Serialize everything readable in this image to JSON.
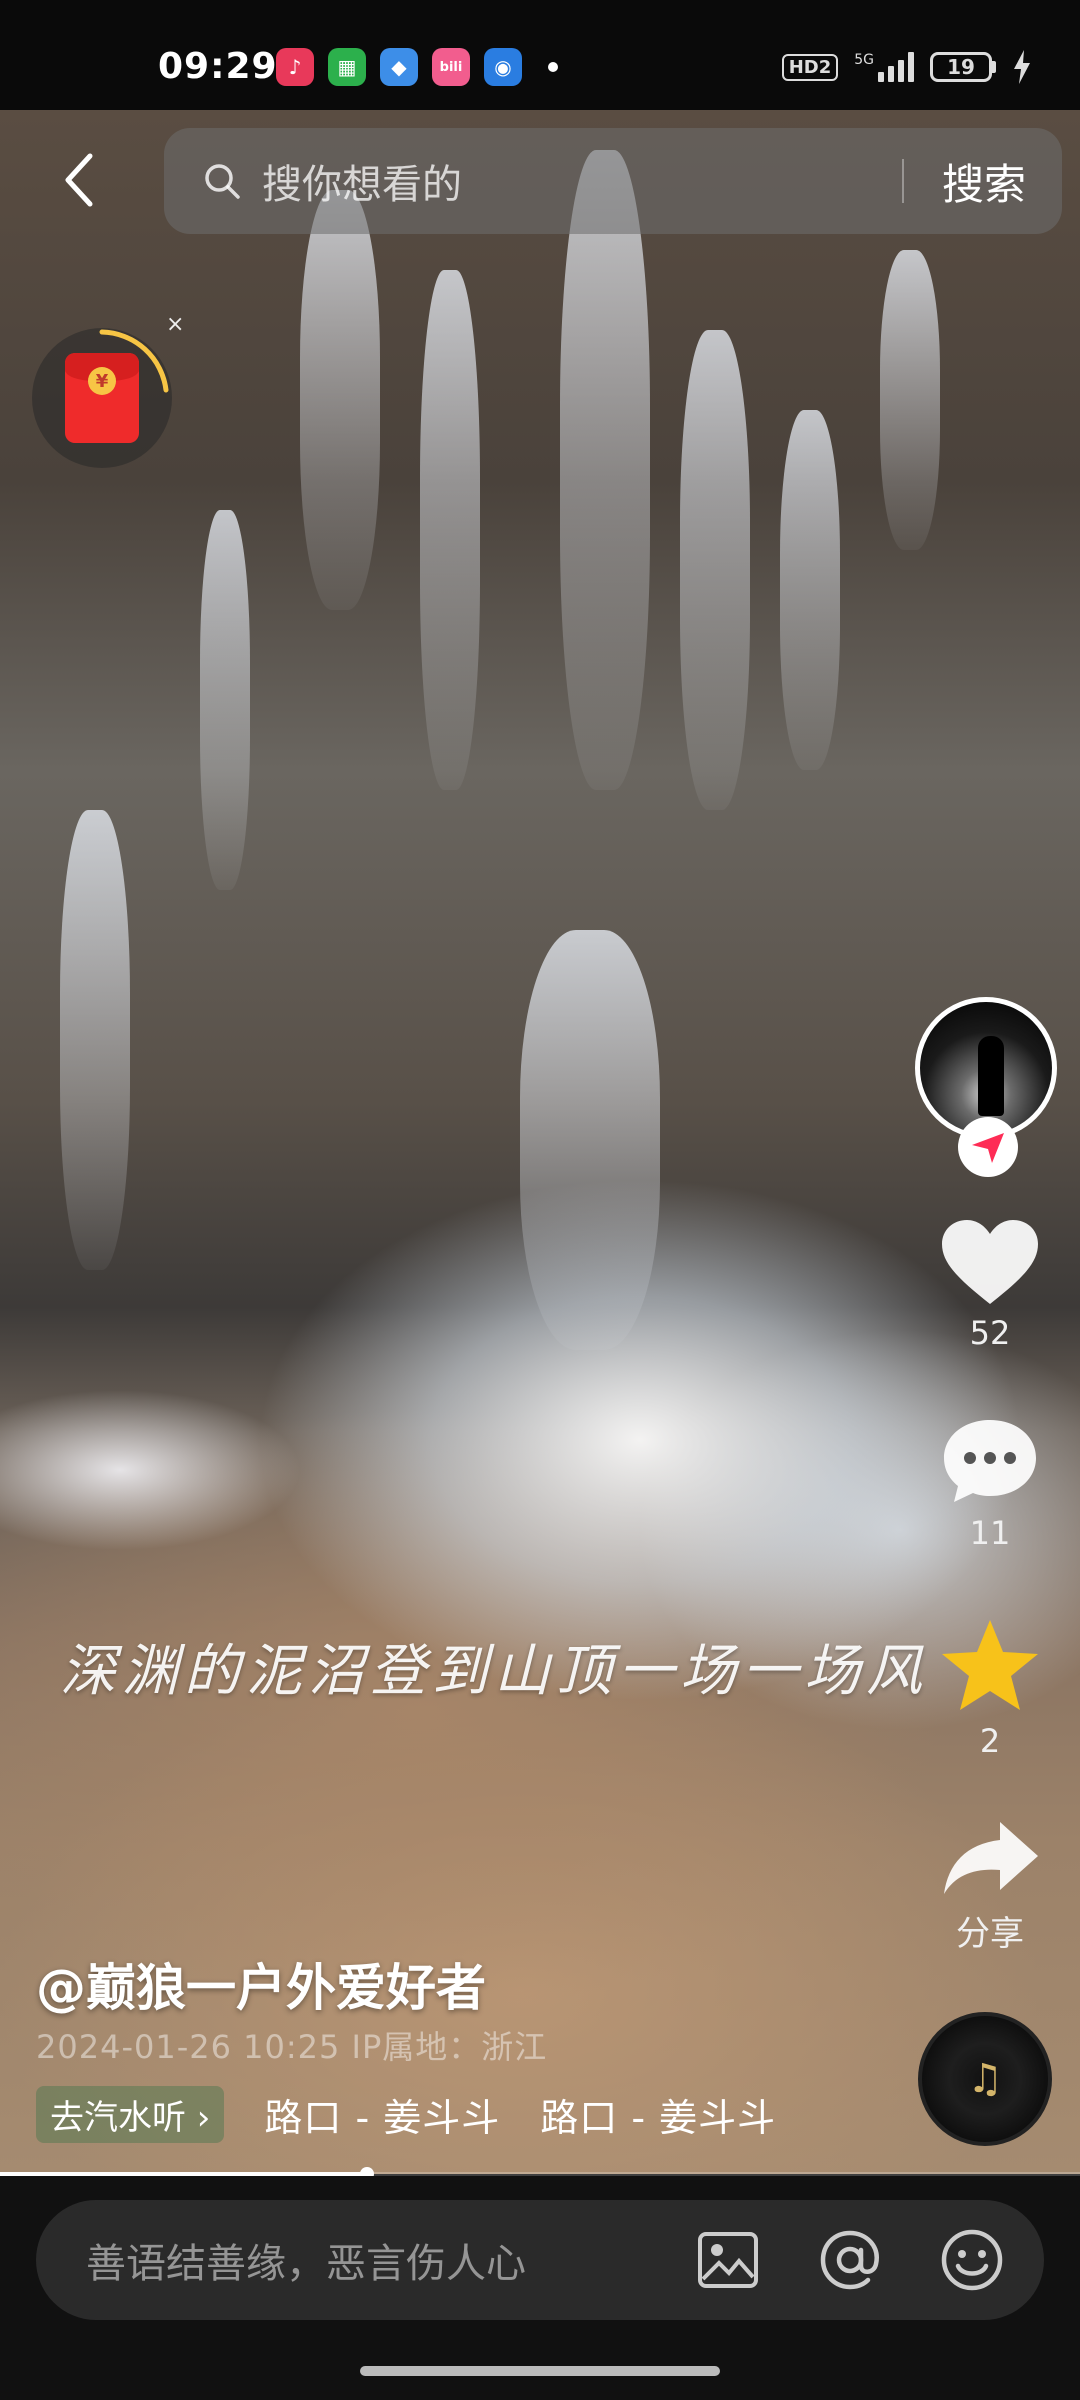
{
  "status_bar": {
    "time": "09:29",
    "hd_label": "HD2",
    "network_label": "5G",
    "battery_level": "19",
    "app_icons": [
      {
        "name": "music-app-icon",
        "color": "#e8395a",
        "glyph": "♪"
      },
      {
        "name": "green-app-icon",
        "color": "#2cb04c",
        "glyph": "▦"
      },
      {
        "name": "blue-app-icon",
        "color": "#3d8ee8",
        "glyph": "◆"
      },
      {
        "name": "bilibili-app-icon",
        "color": "#f25d8e",
        "glyph": "bili"
      },
      {
        "name": "browser-app-icon",
        "color": "#2a7de1",
        "glyph": "◉"
      }
    ]
  },
  "search": {
    "placeholder": "搜你想看的",
    "button_label": "搜索"
  },
  "red_packet": {
    "coin_symbol": "¥",
    "close_label": "×"
  },
  "video": {
    "caption": "深渊的泥沼登到山顶一场一场风"
  },
  "sidebar": {
    "like_count": "52",
    "comment_count": "11",
    "favorite_count": "2",
    "share_label": "分享"
  },
  "post": {
    "author": "@巅狼一户外爱好者",
    "meta": "2024-01-26 10:25 IP属地：浙江",
    "tag": "去汽水听 ›",
    "music_1": "路口 - 姜斗斗",
    "music_2": "路口 - 姜斗斗",
    "progress": 0.34
  },
  "comment_bar": {
    "placeholder": "善语结善缘，恶言伤人心"
  },
  "colors": {
    "accent_red": "#ef2b2b",
    "favorite_yellow": "#f7c21a",
    "follow_red": "#fe2c55"
  }
}
